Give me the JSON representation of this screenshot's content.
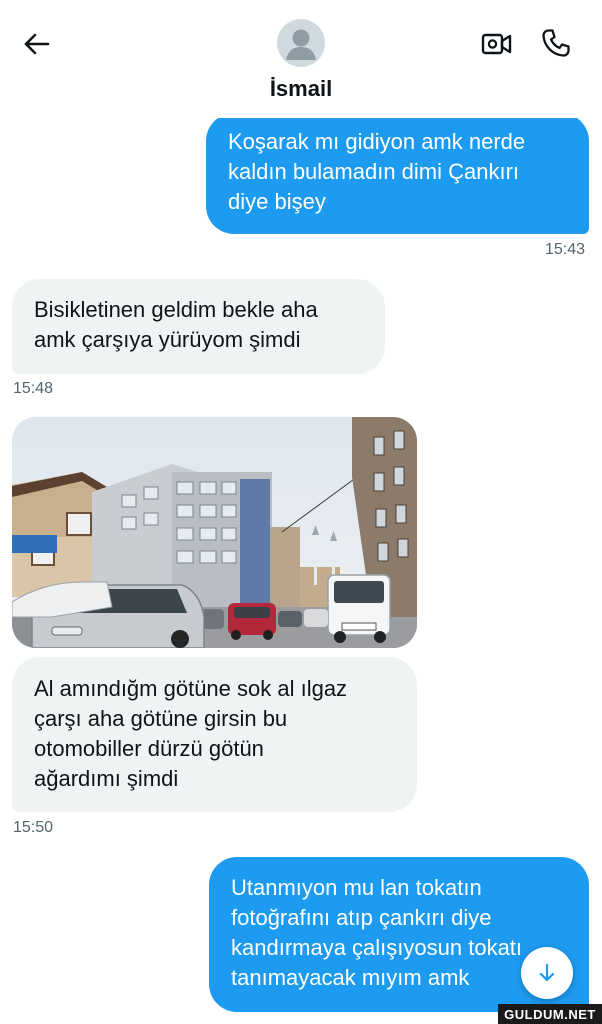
{
  "header": {
    "contact_name": "İsmail",
    "back_icon": "arrow-left-icon",
    "video_icon": "video-camera-icon",
    "call_icon": "phone-icon"
  },
  "messages": [
    {
      "direction": "sent",
      "lines": [
        "Koşarak mı gidiyon amk nerde",
        "kaldın bulamadın dimi Çankırı",
        "diye bişey"
      ],
      "time": "15:43"
    },
    {
      "direction": "received",
      "lines": [
        "Bisikletinen geldim bekle aha",
        "amk çarşıya yürüyom şimdi"
      ],
      "time": "15:48"
    },
    {
      "direction": "received",
      "media": "street-photo",
      "lines": [
        "Al amındığm götüne sok al ılgaz",
        "çarşı aha götüne girsin bu",
        "otomobiller dürzü götün",
        "ağardımı şimdi"
      ],
      "time": "15:50"
    },
    {
      "direction": "sent",
      "lines": [
        "Utanmıyon mu lan tokatın",
        "fotoğrafını atıp çankırı diye",
        "kandırmaya çalışıyosun tokatı",
        "tanımayacak mıyım amk"
      ]
    }
  ],
  "watermark": "GULDUM.NET",
  "colors": {
    "sent_bubble": "#1d9bf0",
    "received_bubble": "#eff3f4",
    "timestamp": "#536471",
    "text": "#0f1419"
  }
}
